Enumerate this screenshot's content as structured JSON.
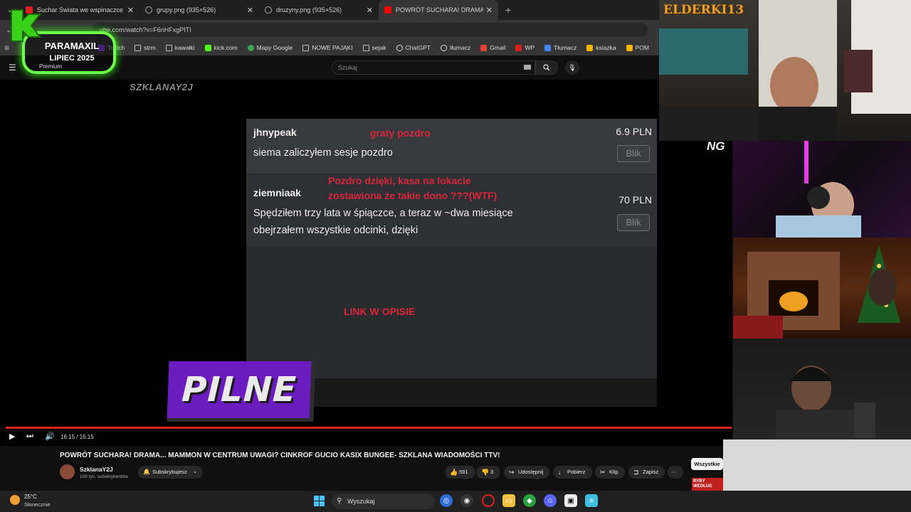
{
  "browser": {
    "tabs": [
      {
        "title": "Suchar Świata we wspinaczce w",
        "active": false
      },
      {
        "title": "grupy.png (935×526)",
        "active": false
      },
      {
        "title": "druzyny.png (935×526)",
        "active": false
      },
      {
        "title": "POWRÓT SUCHARA! DRAMA...",
        "active": true
      }
    ],
    "url": "ube.com/watch?v=F6nHFxgPITI",
    "bookmarks": [
      "witter",
      "Twitch",
      "strm",
      "kawałki",
      "kick.com",
      "Mapy Google",
      "NOWE PAJĄKI",
      "sejak",
      "ChatGPT",
      "tłumacz",
      "Gmail",
      "WP",
      "Tłumacz",
      "ksiazka",
      "POM"
    ]
  },
  "youtube": {
    "search_placeholder": "Szukaj",
    "premium_label": "Premium",
    "video_watermark": "SZKLANAY2J",
    "donations": [
      {
        "name": "jhnypeak",
        "amount": "6.9 PLN",
        "message": "siema zaliczyłem sesje pozdro",
        "blik": "Blik",
        "note": "graty pozdro"
      },
      {
        "name": "ziemniaak",
        "amount": "70 PLN",
        "message_line1": "Spędziłem trzy lata w śpiączce, a teraz w ~dwa miesiące",
        "message_line2": "obejrzałem wszystkie odcinki, dzięki",
        "blik": "Blik",
        "note_line1": "Pozdro dzięki, kasa na lokacie",
        "note_line2": "zostawiona że takie dono ???(WTF)"
      }
    ],
    "link_note": "LINK W OPISIE",
    "pilne_label": "PILNE",
    "time": "16:15 / 16:15",
    "video_title": "POWRÓT SUCHARA! DRAMA... MAMMON W CENTRUM UWAGI? CINKROF GUCIO KASIX BUNGEE- SZKLANA WIADOMOŚCI TTV!",
    "channel_name": "SzklanaY2J",
    "channel_subs": "109 tys. subskrybentów",
    "subscribe_label": "Subskrybujesz",
    "likes": "591",
    "dislikes": "3",
    "share_label": "Udostępnij",
    "download_label": "Pobierz",
    "clip_label": "Klip",
    "save_label": "Zapisz",
    "more_label": "···",
    "chip_all": "Wszystkie"
  },
  "overlay": {
    "badge_line1": "PARAMAXIL",
    "badge_line2": "LIPIEC 2025",
    "cam_logo": "ELDERKI13",
    "ng_logo": "NG",
    "ryby_label": "RYBY WEDŁUG"
  },
  "taskbar": {
    "temperature": "25°C",
    "weather": "Słonecznie",
    "search_label": "Wyszukaj"
  },
  "colors": {
    "accent_red": "#d8253b",
    "progress_red": "#e62117",
    "badge_green": "#6dff4a",
    "pilne_purple": "#6a1cc0"
  }
}
